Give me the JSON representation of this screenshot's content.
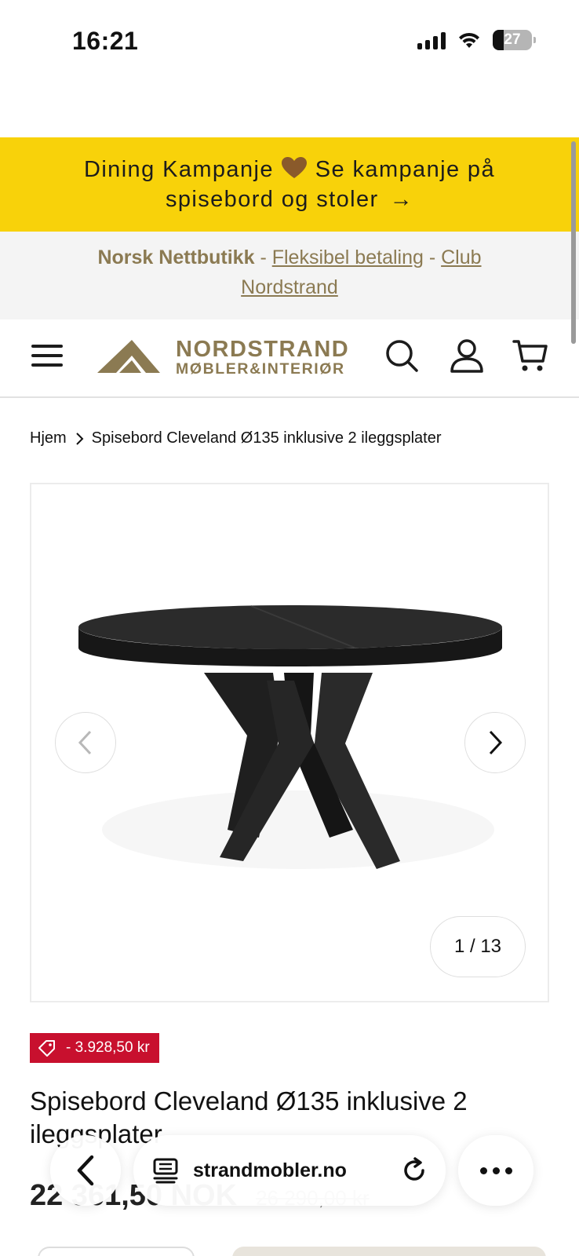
{
  "status_bar": {
    "time": "16:21",
    "battery": "27",
    "battery_fraction": 0.27
  },
  "promo": {
    "text_before_heart": "Dining Kampanje",
    "text_after_heart": "Se kampanje på",
    "line2": "spisebord og stoler",
    "heart_icon": "brown-heart-icon",
    "arrow": "→",
    "color": "#f8d20a"
  },
  "info": {
    "bold": "Norsk Nettbutikk",
    "sep1": " - ",
    "link1": "Fleksibel betaling",
    "sep2": " - ",
    "link2_part1": "Club",
    "link2_part2": "Nordstrand",
    "accent_color": "#8b7a52"
  },
  "header": {
    "logo_line1": "NORDSTRAND",
    "logo_line2": "MØBLER&INTERIØR",
    "icons": [
      "menu-icon",
      "search-icon",
      "account-icon",
      "cart-icon"
    ]
  },
  "breadcrumb": {
    "home": "Hjem",
    "current": "Spisebord Cleveland Ø135 inklusive 2 ileggsplater"
  },
  "gallery": {
    "counter": "1 / 13",
    "current_index": 1,
    "total": 13
  },
  "product": {
    "discount": "- 3.928,50 kr",
    "title": "Spisebord Cleveland Ø135 inklusive 2 ileggsplater",
    "price_now": "22 361,50 NOK",
    "price_old": "26 290,00 kr",
    "discount_color": "#c8102e"
  },
  "browser": {
    "url": "strandmobler.no",
    "icons": [
      "back-icon",
      "tabs-icon",
      "reload-icon",
      "more-icon"
    ]
  }
}
